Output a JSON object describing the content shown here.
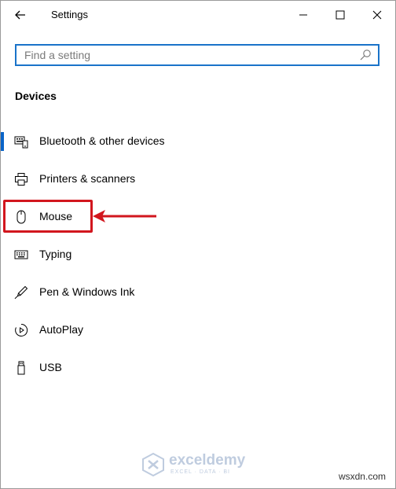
{
  "window": {
    "title": "Settings",
    "controls": {
      "minimize_icon": "minimize-icon",
      "maximize_icon": "maximize-icon",
      "close_icon": "close-icon"
    }
  },
  "search": {
    "placeholder": "Find a setting",
    "value": ""
  },
  "section": {
    "heading": "Devices"
  },
  "nav": {
    "items": [
      {
        "label": "Bluetooth & other devices",
        "icon": "bluetooth-devices-icon",
        "selected": true
      },
      {
        "label": "Printers & scanners",
        "icon": "printer-icon",
        "selected": false
      },
      {
        "label": "Mouse",
        "icon": "mouse-icon",
        "selected": false
      },
      {
        "label": "Typing",
        "icon": "keyboard-icon",
        "selected": false
      },
      {
        "label": "Pen & Windows Ink",
        "icon": "pen-icon",
        "selected": false
      },
      {
        "label": "AutoPlay",
        "icon": "autoplay-icon",
        "selected": false
      },
      {
        "label": "USB",
        "icon": "usb-icon",
        "selected": false
      }
    ]
  },
  "colors": {
    "accent": "#0a64c8",
    "search_border": "#1a73c9",
    "annotation": "#d2161e"
  },
  "watermark": {
    "name": "exceldemy",
    "tagline": "EXCEL · DATA · BI"
  },
  "site_mark": "wsxdn.com"
}
